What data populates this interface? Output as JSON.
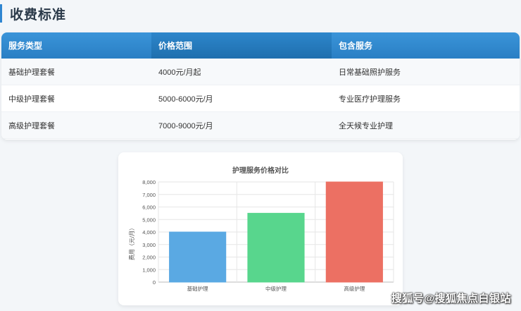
{
  "page": {
    "title": "收费标准"
  },
  "table": {
    "headers": [
      "服务类型",
      "价格范围",
      "包含服务"
    ],
    "rows": [
      [
        "基础护理套餐",
        "4000元/月起",
        "日常基础照护服务"
      ],
      [
        "中级护理套餐",
        "5000-6000元/月",
        "专业医疗护理服务"
      ],
      [
        "高级护理套餐",
        "7000-9000元/月",
        "全天候专业护理"
      ]
    ]
  },
  "chart_data": {
    "type": "bar",
    "title": "护理服务价格对比",
    "categories": [
      "基础护理",
      "中级护理",
      "高级护理"
    ],
    "values": [
      4000,
      5500,
      8000
    ],
    "ylabel": "费用（元/月）",
    "xlabel": "",
    "ylim": [
      0,
      8000
    ],
    "yticks": [
      "0",
      "1,000",
      "2,000",
      "3,000",
      "4,000",
      "5,000",
      "6,000",
      "7,000",
      "8,000"
    ],
    "colors": [
      "#5aa9e3",
      "#58d68d",
      "#ec7063"
    ],
    "grid": true
  },
  "watermark": "搜狐号@搜狐焦点白银站"
}
